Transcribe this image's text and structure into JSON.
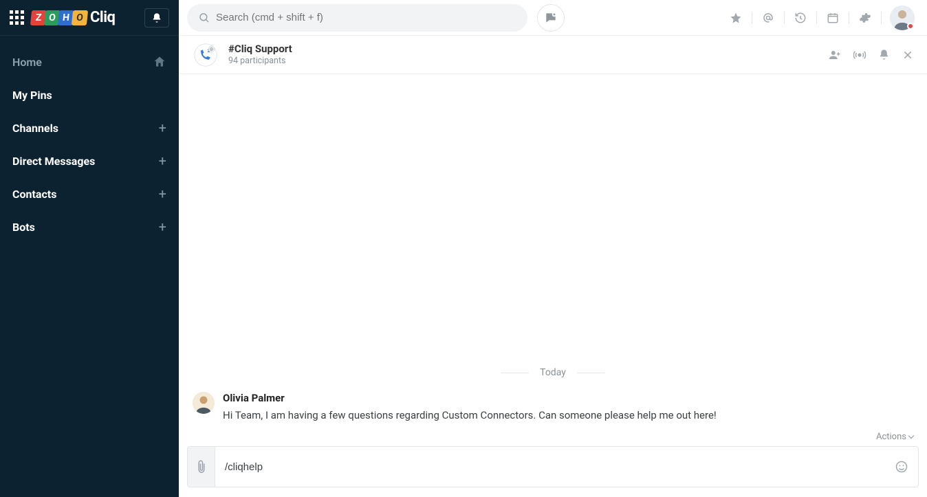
{
  "app": {
    "name": "Cliq",
    "logo_letters": [
      "Z",
      "O",
      "H",
      "O"
    ]
  },
  "search": {
    "placeholder": "Search (cmd + shift + f)"
  },
  "sidebar": {
    "home": "Home",
    "items": [
      {
        "label": "My Pins",
        "has_plus": false
      },
      {
        "label": "Channels",
        "has_plus": true
      },
      {
        "label": "Direct Messages",
        "has_plus": true
      },
      {
        "label": "Contacts",
        "has_plus": true
      },
      {
        "label": "Bots",
        "has_plus": true
      }
    ]
  },
  "channel": {
    "title": "#Cliq Support",
    "subtitle": "94 participants"
  },
  "messages": {
    "day_label": "Today",
    "items": [
      {
        "author": "Olivia Palmer",
        "text": "Hi Team, I am having a few questions regarding Custom Connectors. Can someone please help me out here!"
      }
    ],
    "actions_label": "Actions"
  },
  "composer": {
    "value": "/cliqhelp"
  },
  "colors": {
    "sidebar_bg": "#0d2230",
    "status_red": "#e64545"
  }
}
